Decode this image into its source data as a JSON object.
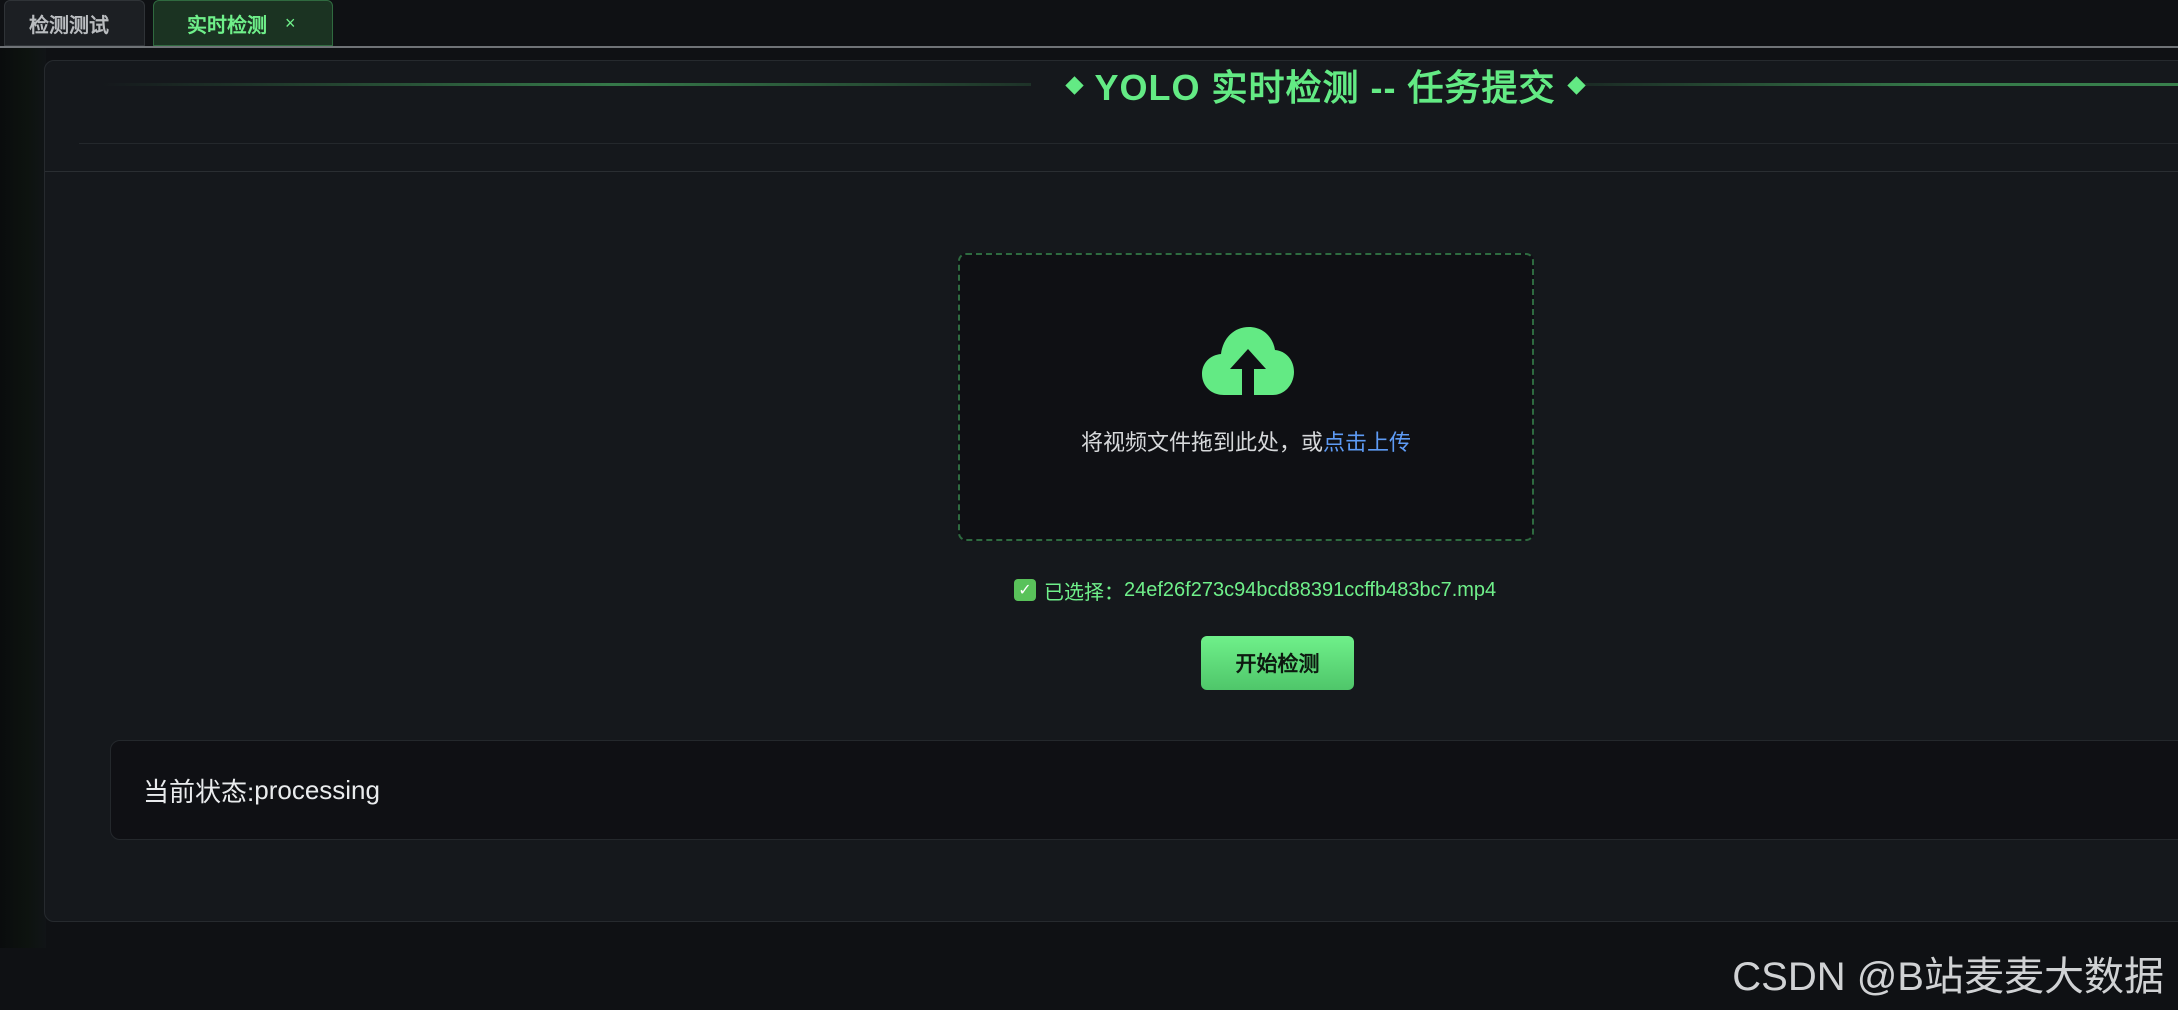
{
  "tabs": [
    {
      "label": "检测测试",
      "active": false
    },
    {
      "label": "实时检测",
      "active": true,
      "close": "×"
    }
  ],
  "header": {
    "title": "YOLO 实时检测 -- 任务提交"
  },
  "upload": {
    "text": "将视频文件拖到此处，或",
    "link": "点击上传",
    "icon": "upload-cloud-icon"
  },
  "selected": {
    "check": "✓",
    "prefix": "已选择：",
    "filename": "24ef26f273c94bcd88391ccffb483bc7.mp4"
  },
  "actions": {
    "start_label": "开始检测"
  },
  "status": {
    "label": "当前状态: ",
    "value": "processing"
  },
  "watermark": "CSDN @B站麦麦大数据",
  "colors": {
    "accent": "#63ea84",
    "link": "#5e9bf5",
    "background": "#0f1114"
  }
}
